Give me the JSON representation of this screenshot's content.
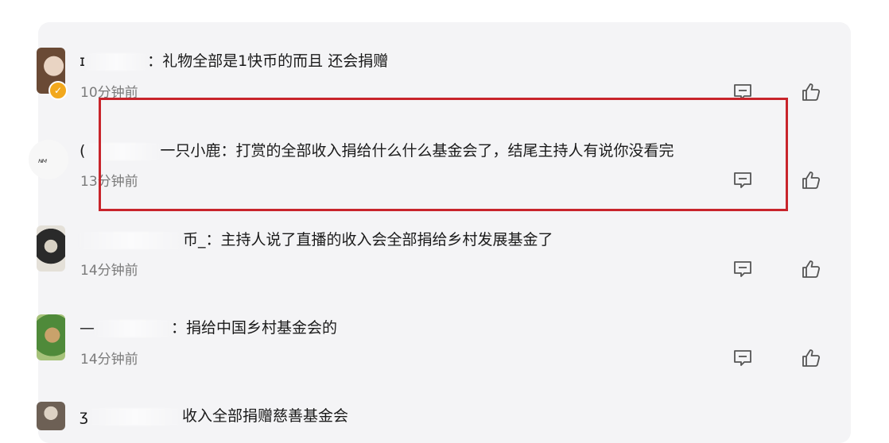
{
  "comments": [
    {
      "user_fragment_left": "ɪ",
      "user_fragment_right": "",
      "separator": "：",
      "text": "礼物全部是1快币的而且 还会捐赠",
      "time": "10分钟前",
      "verified": true
    },
    {
      "user_fragment_left": "(",
      "user_fragment_right": "一只小鹿",
      "separator": "：",
      "text": "打赏的全部收入捐给什么什么基金会了，结尾主持人有说你没看完",
      "time": "13分钟前",
      "avatar_mark": "ᴺᴹ"
    },
    {
      "user_fragment_left": "",
      "user_fragment_right": "币_",
      "separator": "：",
      "text": "主持人说了直播的收入会全部捐给乡村发展基金了",
      "time": "14分钟前"
    },
    {
      "user_fragment_left": "—",
      "user_fragment_right": "",
      "separator": "：",
      "text": "捐给中国乡村基金会的",
      "time": "14分钟前"
    },
    {
      "user_fragment_left": "ʒ",
      "user_fragment_right": "",
      "separator": "",
      "text": "收入全部捐赠慈善基金会",
      "time": ""
    }
  ],
  "icons": {
    "reply": "comment-icon",
    "like": "thumbs-up-icon",
    "verified": "verified-badge-icon"
  },
  "colors": {
    "highlight_border": "#c8242b",
    "panel_bg": "#f4f4f6",
    "verified": "#f2a81d",
    "time_text": "#7a7a7a"
  }
}
